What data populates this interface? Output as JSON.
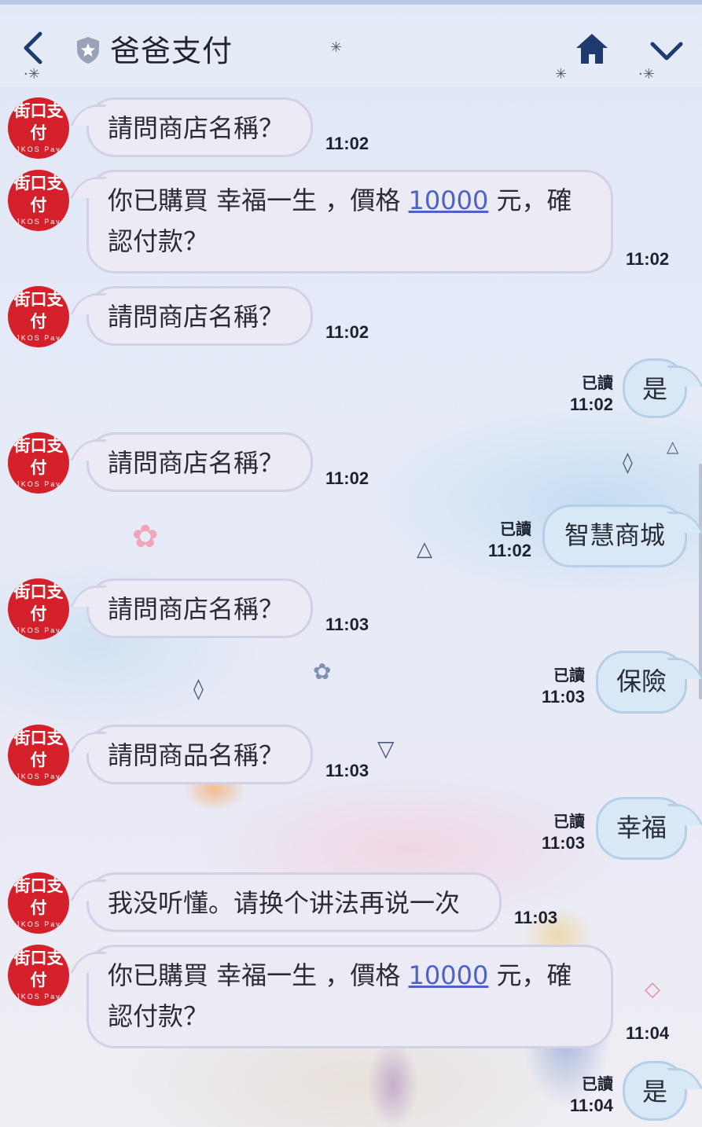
{
  "header": {
    "title": "爸爸支付",
    "back_icon": "back-arrow-icon",
    "home_icon": "home-icon",
    "menu_icon": "chevron-down-icon"
  },
  "avatar": {
    "main": "街口支付",
    "sub": "JKOS Pay"
  },
  "messages": [
    {
      "dir": "in",
      "text": "請問商店名稱？",
      "time": "11:02"
    },
    {
      "dir": "in",
      "parts": [
        "你已購買 幸福一生 ，價格 ",
        "10000",
        " 元，確",
        "認付款？"
      ],
      "time": "11:02"
    },
    {
      "dir": "in",
      "text": "請問商店名稱？",
      "time": "11:02"
    },
    {
      "dir": "out",
      "text": "是",
      "read": "已讀",
      "time": "11:02"
    },
    {
      "dir": "in",
      "text": "請問商店名稱？",
      "time": "11:02"
    },
    {
      "dir": "out",
      "text": "智慧商城",
      "read": "已讀",
      "time": "11:02"
    },
    {
      "dir": "in",
      "text": "請問商店名稱？",
      "time": "11:03"
    },
    {
      "dir": "out",
      "text": "保險",
      "read": "已讀",
      "time": "11:03"
    },
    {
      "dir": "in",
      "text": "請問商品名稱？",
      "time": "11:03"
    },
    {
      "dir": "out",
      "text": "幸福",
      "read": "已讀",
      "time": "11:03"
    },
    {
      "dir": "in",
      "text": "我没听懂。请换个讲法再说一次",
      "time": "11:03"
    },
    {
      "dir": "in",
      "parts": [
        "你已購買 幸福一生 ，價格 ",
        "10000",
        " 元，確",
        "認付款？"
      ],
      "time": "11:04"
    },
    {
      "dir": "out",
      "text": "是",
      "read": "已讀",
      "time": "11:04"
    }
  ],
  "colors": {
    "incoming_bubble": "#ecebf5",
    "outgoing_bubble": "#d9e8f6",
    "link": "#4b62c7",
    "avatar_red": "#d4202a"
  }
}
